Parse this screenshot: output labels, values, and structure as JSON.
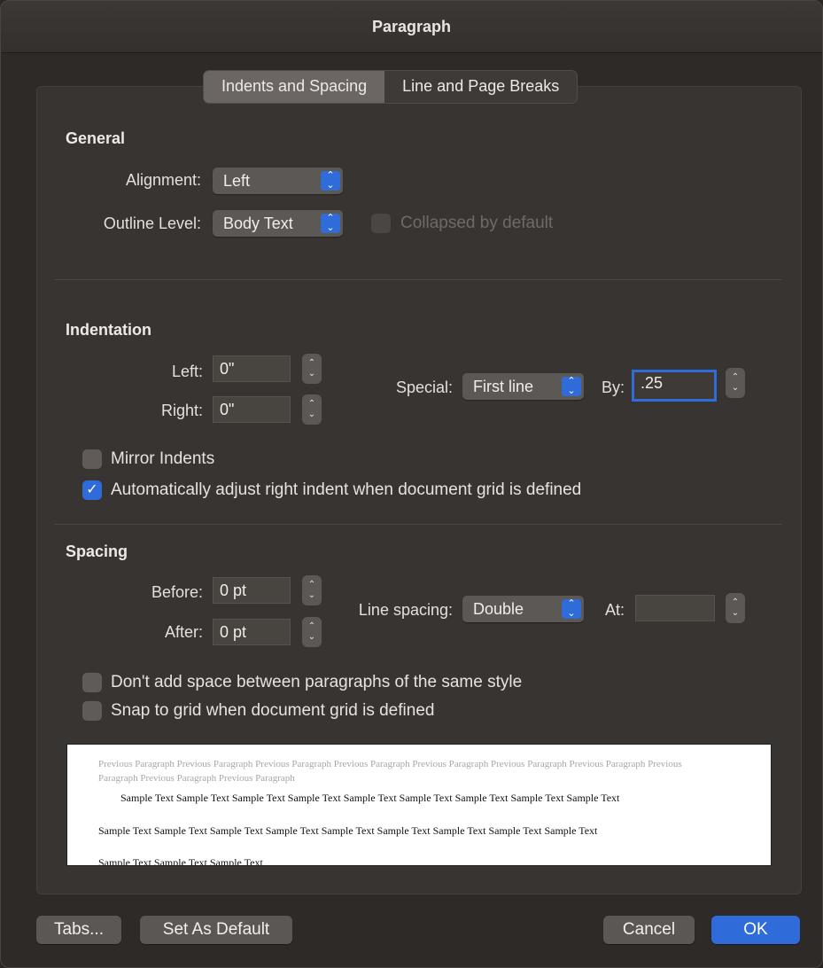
{
  "window": {
    "title": "Paragraph"
  },
  "tabs": [
    {
      "label": "Indents and Spacing",
      "active": true
    },
    {
      "label": "Line and Page Breaks",
      "active": false
    }
  ],
  "general": {
    "title": "General",
    "alignment": {
      "label": "Alignment:",
      "value": "Left"
    },
    "outline_level": {
      "label": "Outline Level:",
      "value": "Body Text"
    },
    "collapsed": {
      "label": "Collapsed by default",
      "checked": false,
      "enabled": false
    }
  },
  "indentation": {
    "title": "Indentation",
    "left": {
      "label": "Left:",
      "value": "0\""
    },
    "right": {
      "label": "Right:",
      "value": "0\""
    },
    "special": {
      "label": "Special:",
      "value": "First line"
    },
    "by": {
      "label": "By:",
      "value": ".25"
    },
    "mirror": {
      "label": "Mirror Indents",
      "checked": false
    },
    "auto_adjust": {
      "label": "Automatically adjust right indent when document grid is defined",
      "checked": true
    }
  },
  "spacing": {
    "title": "Spacing",
    "before": {
      "label": "Before:",
      "value": "0 pt"
    },
    "after": {
      "label": "After:",
      "value": "0 pt"
    },
    "line_spacing": {
      "label": "Line spacing:",
      "value": "Double"
    },
    "at": {
      "label": "At:",
      "value": ""
    },
    "no_space_same_style": {
      "label": "Don't add space between paragraphs of the same style",
      "checked": false
    },
    "snap_to_grid": {
      "label": "Snap to grid when document grid is defined",
      "checked": false
    }
  },
  "preview": {
    "previous_text": "Previous Paragraph Previous Paragraph Previous Paragraph Previous Paragraph Previous Paragraph Previous Paragraph Previous Paragraph Previous Paragraph Previous Paragraph Previous Paragraph",
    "sample_line1": "Sample Text Sample Text Sample Text Sample Text Sample Text Sample Text Sample Text Sample Text Sample Text",
    "sample_line2": "Sample Text Sample Text Sample Text Sample Text Sample Text Sample Text Sample Text Sample Text Sample Text",
    "sample_line3": "Sample Text Sample Text Sample Text"
  },
  "buttons": {
    "tabs": "Tabs...",
    "set_default": "Set As Default",
    "cancel": "Cancel",
    "ok": "OK"
  },
  "colors": {
    "accent": "#2f6bd9",
    "background": "#2e2a28"
  }
}
